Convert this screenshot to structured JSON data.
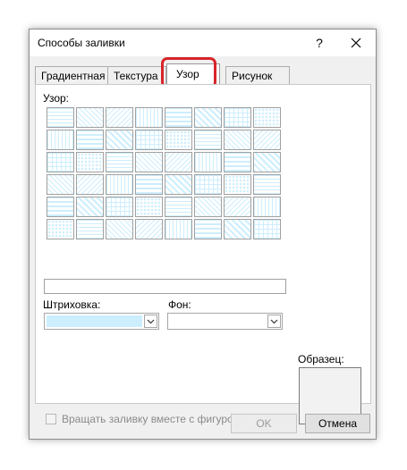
{
  "dialog": {
    "title": "Способы заливки",
    "help_label": "?",
    "tabs": [
      {
        "label": "Градиентная"
      },
      {
        "label": "Текстура"
      },
      {
        "label": "Узор",
        "active": true
      },
      {
        "label": "Рисунок"
      }
    ],
    "pattern_label": "Узор:",
    "hatch_label": "Штриховка:",
    "background_label": "Фон:",
    "hatch_color": "#cdeefe",
    "background_color": "#ffffff",
    "sample_label": "Образец:",
    "rotate_checkbox_label": "Вращать заливку вместе с фигурой",
    "rotate_checked": false,
    "ok_label": "OK",
    "cancel_label": "Отмена",
    "highlight_color": "#d9252a"
  }
}
